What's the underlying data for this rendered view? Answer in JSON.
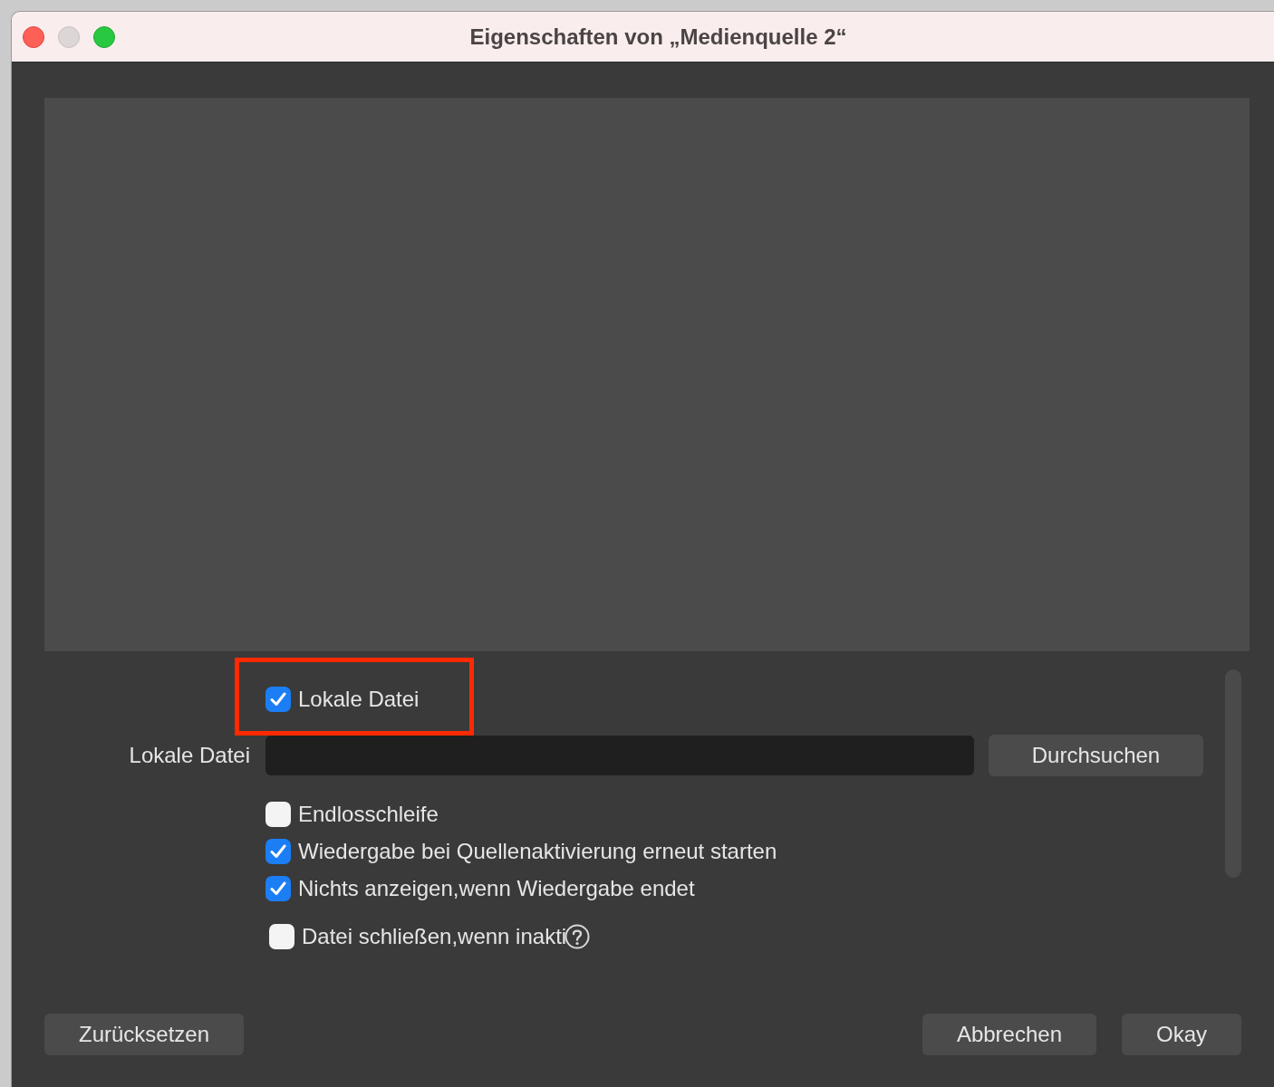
{
  "window": {
    "title": "Eigenschaften von „Medienquelle 2“"
  },
  "controls": [
    {
      "kind": "checkbox",
      "label": "Lokale Datei",
      "checked": true,
      "highlighted": true,
      "help": false
    },
    {
      "kind": "file",
      "label": "Lokale Datei",
      "button": "Durchsuchen"
    },
    {
      "kind": "checkbox",
      "label": "Endlosschleife",
      "checked": false,
      "highlighted": false,
      "help": false
    },
    {
      "kind": "checkbox",
      "label": "Wiedergabe bei Quellenaktivierung erneut starten",
      "checked": true,
      "highlighted": false,
      "help": false
    },
    {
      "kind": "checkbox",
      "label": "Nichts anzeigen,wenn Wiedergabe endet",
      "checked": true,
      "highlighted": false,
      "help": false
    },
    {
      "kind": "checkbox",
      "label": "Datei schließen,wenn inakti",
      "checked": false,
      "highlighted": false,
      "help": true
    }
  ],
  "buttons": {
    "left": [
      "Zurücksetzen"
    ],
    "right": [
      "Abbrechen",
      "Okay"
    ]
  }
}
